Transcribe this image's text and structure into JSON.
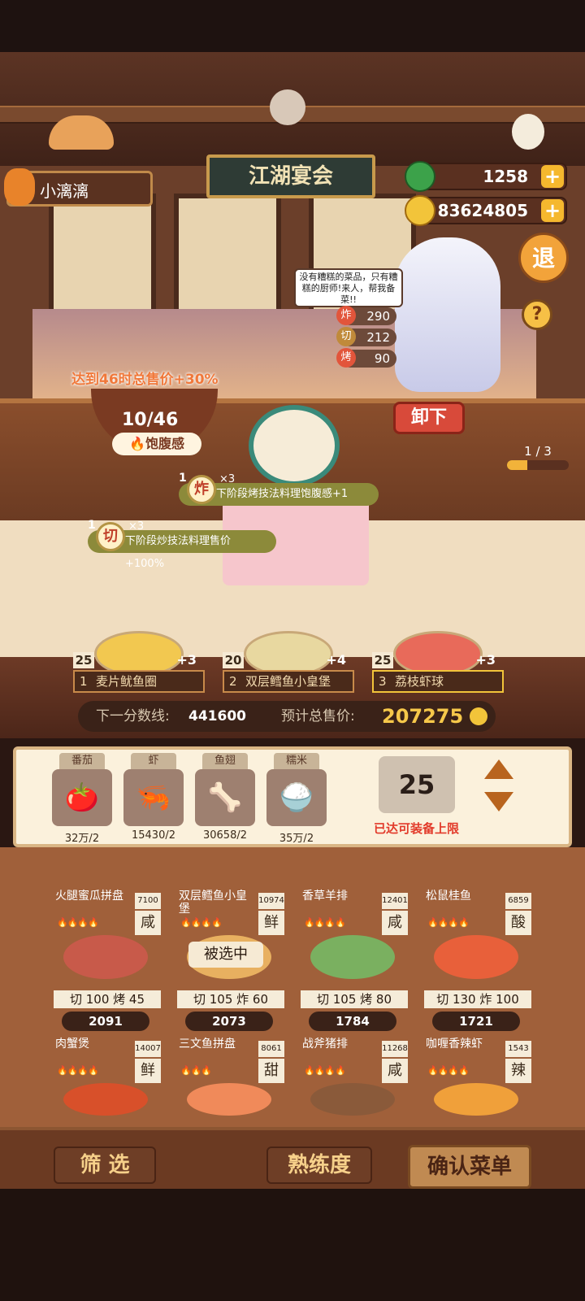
{
  "player": {
    "name": "小漓漓"
  },
  "resources": {
    "jade": "1258",
    "coins": "83624805"
  },
  "restaurant_sign": "江湖宴会",
  "chef": {
    "speech": "没有糟糕的菜品，只有糟糕的厨师!来人，帮我备菜!!",
    "stats": [
      {
        "skill": "炸",
        "value": "290"
      },
      {
        "skill": "切",
        "value": "212"
      },
      {
        "skill": "烤",
        "value": "90"
      }
    ],
    "unload_label": "卸下"
  },
  "buttons": {
    "retreat": "退",
    "help": "?",
    "filter": "筛 选",
    "proficiency": "熟练度",
    "confirm": "确认菜单"
  },
  "satiety": {
    "bonus_text": "达到46时总售价+30%",
    "count": "10/46",
    "label": "饱腹感"
  },
  "page_indicator": {
    "text": "1 / 3",
    "progress": 0.33
  },
  "skill_tips": [
    {
      "level": "1",
      "skill": "炸",
      "mult": "×3",
      "text": "下阶段烤技法料理饱腹感+1"
    },
    {
      "level": "1",
      "skill": "切",
      "mult": "×3",
      "text": "下阶段炒技法料理售价+100%"
    }
  ],
  "menu_slots": [
    {
      "index": "1",
      "name": "麦片鱿鱼圈",
      "count": "25",
      "heat": "+3"
    },
    {
      "index": "2",
      "name": "双层鳕鱼小皇堡",
      "count": "20",
      "heat": "+4"
    },
    {
      "index": "3",
      "name": "荔枝虾球",
      "count": "25",
      "heat": "+3"
    }
  ],
  "score": {
    "next_label": "下一分数线:",
    "next_value": "441600",
    "total_label": "预计总售价:",
    "total_value": "207275"
  },
  "ingredients": [
    {
      "name": "番茄",
      "qty": "32万/2",
      "icon": "🍅"
    },
    {
      "name": "虾",
      "qty": "15430/2",
      "icon": "🦐"
    },
    {
      "name": "鱼翅",
      "qty": "30658/2",
      "icon": "🦴"
    },
    {
      "name": "糯米",
      "qty": "35万/2",
      "icon": "🍚"
    }
  ],
  "equip": {
    "value": "25",
    "limit_text": "已达可装备上限"
  },
  "recipes": [
    {
      "name": "火腿蜜瓜拼盘",
      "rank": "7100",
      "flavor": "咸",
      "hearts": "🔥🔥🔥🔥",
      "stats": "切 100  烤 45",
      "price": "2091",
      "color": "#c85a4a"
    },
    {
      "name": "双层鳕鱼小皇堡",
      "rank": "10974",
      "flavor": "鲜",
      "hearts": "🔥🔥🔥🔥",
      "stats": "切 105  炸 60",
      "price": "2073",
      "color": "#e8b060"
    },
    {
      "name": "香草羊排",
      "rank": "12401",
      "flavor": "咸",
      "hearts": "🔥🔥🔥🔥",
      "stats": "切 105  烤 80",
      "price": "1784",
      "color": "#7ab060"
    },
    {
      "name": "松鼠桂鱼",
      "rank": "6859",
      "flavor": "酸",
      "hearts": "🔥🔥🔥🔥",
      "stats": "切 130  炸 100",
      "price": "1721",
      "color": "#e8603a"
    },
    {
      "name": "肉蟹煲",
      "rank": "14007",
      "flavor": "鲜",
      "hearts": "🔥🔥🔥🔥",
      "color": "#d8502a"
    },
    {
      "name": "三文鱼拼盘",
      "rank": "8061",
      "flavor": "甜",
      "hearts": "🔥🔥🔥",
      "color": "#f08a5a"
    },
    {
      "name": "战斧猪排",
      "rank": "11268",
      "flavor": "咸",
      "hearts": "🔥🔥🔥🔥",
      "color": "#8a5a3a"
    },
    {
      "name": "咖喱香辣虾",
      "rank": "1543",
      "flavor": "辣",
      "hearts": "🔥🔥🔥🔥",
      "color": "#f0a03a"
    }
  ],
  "selected_label": "被选中"
}
